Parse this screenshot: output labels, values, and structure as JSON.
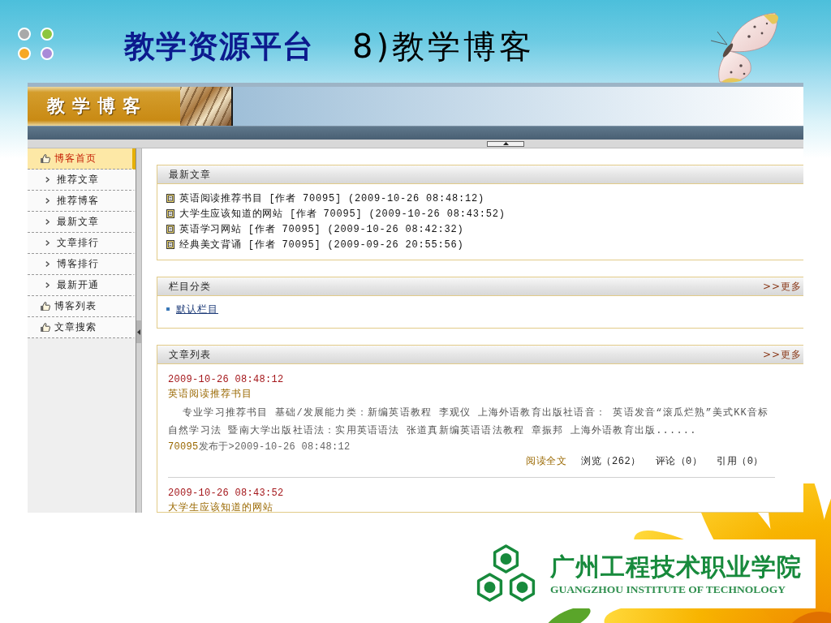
{
  "slide": {
    "title": "教学资源平台",
    "subtitle": "8)教学博客"
  },
  "banner": {
    "title": "教学博客"
  },
  "sidebar": {
    "items": [
      {
        "label": "博客首页",
        "kind": "section",
        "selected": true,
        "children": [
          {
            "label": "推荐文章",
            "kind": "link",
            "selected": false
          },
          {
            "label": "推荐博客",
            "kind": "link",
            "selected": false
          },
          {
            "label": "最新文章",
            "kind": "link",
            "selected": false
          },
          {
            "label": "文章排行",
            "kind": "link",
            "selected": false
          },
          {
            "label": "博客排行",
            "kind": "link",
            "selected": false
          },
          {
            "label": "最新开通",
            "kind": "link",
            "selected": false
          }
        ]
      },
      {
        "label": "博客列表",
        "kind": "section",
        "selected": false
      },
      {
        "label": "文章搜索",
        "kind": "section",
        "selected": false
      }
    ]
  },
  "latest_articles": {
    "title": "最新文章",
    "items": [
      "英语阅读推荐书目 [作者 70095] (2009-10-26 08:48:12)",
      "大学生应该知道的网站 [作者 70095] (2009-10-26 08:43:52)",
      "英语学习网站 [作者 70095] (2009-10-26 08:42:32)",
      "经典美文背诵 [作者 70095] (2009-09-26 20:55:56)"
    ]
  },
  "categories": {
    "title": "栏目分类",
    "more": ">>更多",
    "items": [
      "默认栏目"
    ]
  },
  "article_list": {
    "title": "文章列表",
    "more": ">>更多",
    "entries": [
      {
        "date": "2009-10-26 08:48:12",
        "title": "英语阅读推荐书目",
        "summary": "专业学习推荐书目 基础/发展能力类：新编英语教程 李观仪 上海外语教育出版社语音： 英语发音“滚瓜烂熟”美式KK音标自然学习法 暨南大学出版社语法：实用英语语法 张道真新编英语语法教程 章振邦 上海外语教育出版......",
        "author": "70095",
        "posted": "发布于>2009-10-26 08:48:12",
        "read_more": "阅读全文",
        "stats": [
          "浏览（262）",
          "评论（0）",
          "引用（0）"
        ]
      },
      {
        "date": "2009-10-26 08:43:52",
        "title": "大学生应该知道的网站"
      }
    ]
  },
  "logo": {
    "name": "广州工程技术职业学院",
    "name_en": "GUANGZHOU INSTITUTE OF TECHNOLOGY"
  }
}
